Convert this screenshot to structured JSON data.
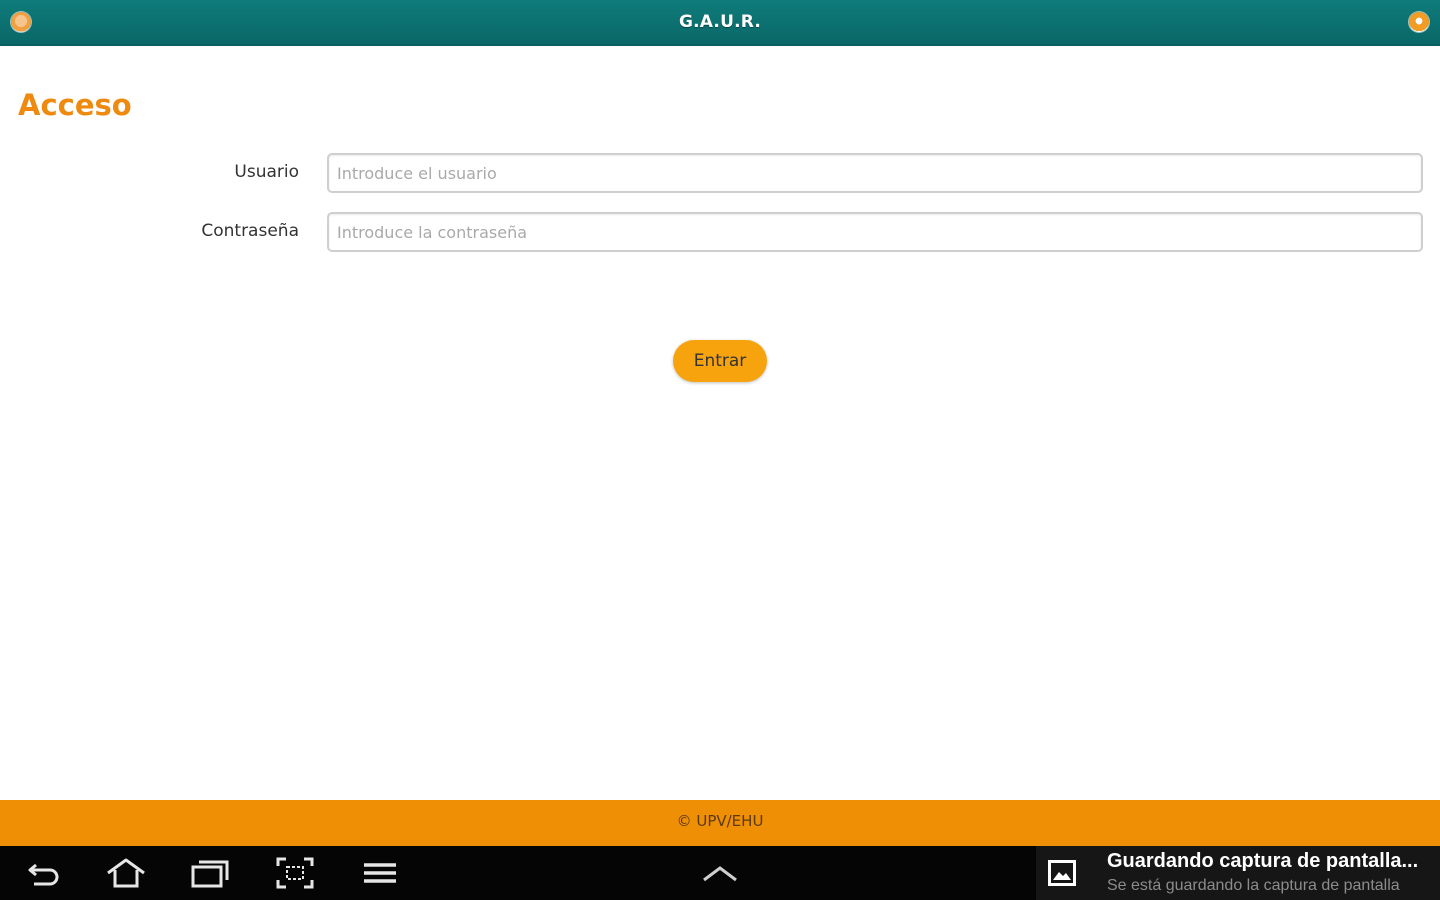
{
  "app": {
    "title": "G.A.U.R."
  },
  "login": {
    "heading": "Acceso",
    "username_label": "Usuario",
    "username_placeholder": "Introduce el usuario",
    "username_value": "",
    "password_label": "Contraseña",
    "password_placeholder": "Introduce la contraseña",
    "password_value": "",
    "submit_label": "Entrar"
  },
  "footer": {
    "text": "© UPV/EHU"
  },
  "system_nav": {
    "icons": [
      "back-icon",
      "home-icon",
      "recent-apps-icon",
      "screenshot-icon",
      "menu-icon",
      "chevron-up-icon"
    ]
  },
  "notification": {
    "icon": "image-icon",
    "title": "Guardando captura de pantalla...",
    "subtitle": "Se está guardando la captura de pantalla"
  },
  "colors": {
    "header": "#0f7c7b",
    "accent": "#ee8a10",
    "button": "#f7a30e",
    "footer": "#ee8f06",
    "navbar": "#050505"
  }
}
